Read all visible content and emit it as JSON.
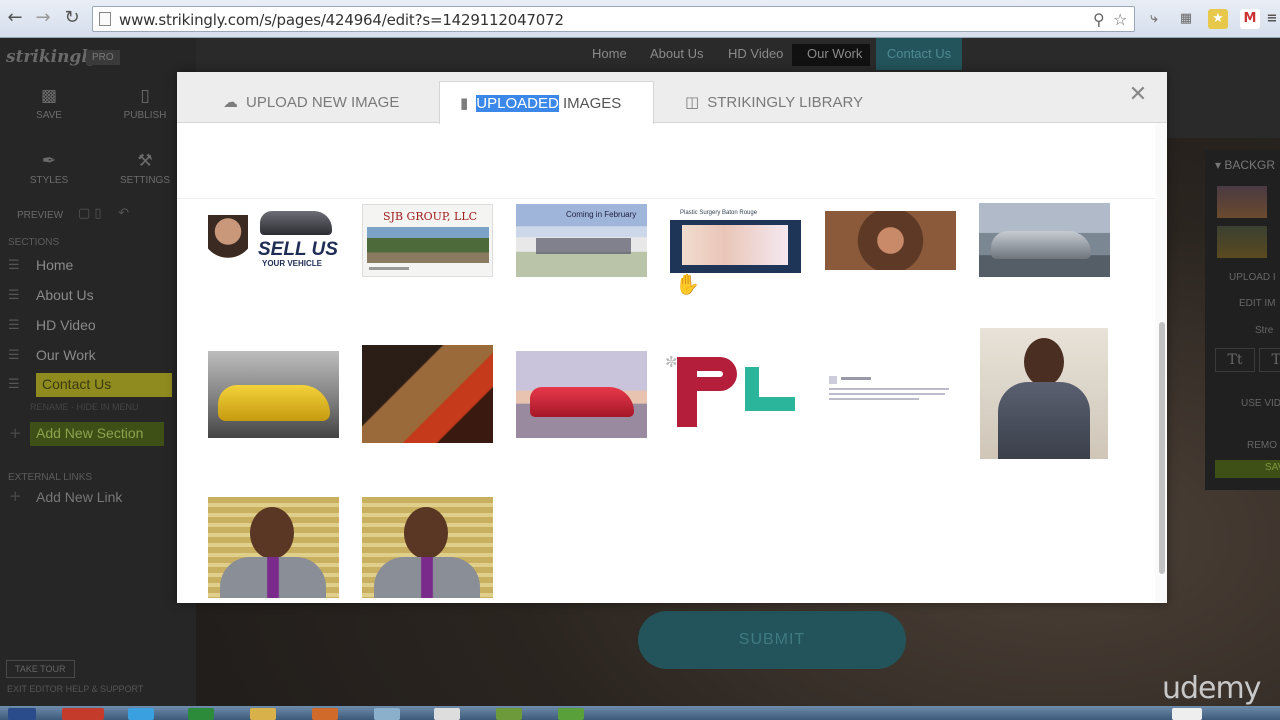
{
  "browser": {
    "url": "www.strikingly.com/s/pages/424964/edit?s=1429112047072",
    "back_icon": "arrow-left-icon",
    "forward_icon": "arrow-right-icon",
    "reload_icon": "reload-icon"
  },
  "sidebar": {
    "logo": "strikingly",
    "badge": "PRO",
    "tools": [
      {
        "label": "SAVE",
        "icon": "save-icon"
      },
      {
        "label": "PUBLISH",
        "icon": "publish-icon"
      },
      {
        "label": "STYLES",
        "icon": "brush-icon"
      },
      {
        "label": "SETTINGS",
        "icon": "wrench-icon"
      }
    ],
    "preview_label": "PREVIEW",
    "sections_header": "SECTIONS",
    "sections": [
      "Home",
      "About Us",
      "HD Video",
      "Our Work",
      "Contact Us"
    ],
    "active_section": "Contact Us",
    "section_actions": "RENAME · HIDE IN MENU",
    "add_section": "Add New Section",
    "external_header": "EXTERNAL LINKS",
    "add_link": "Add New Link",
    "take_tour": "TAKE TOUR",
    "footer": "EXIT EDITOR   HELP & SUPPORT"
  },
  "site": {
    "nav": [
      "Home",
      "About Us",
      "HD Video",
      "Our Work",
      "Contact Us"
    ],
    "submit": "SUBMIT",
    "watermark": "udemy"
  },
  "right_panel": {
    "header": "BACKGR",
    "upload": "UPLOAD I",
    "edit": "EDIT IM",
    "stretch": "Stre",
    "use_video": "USE VID",
    "remove": "REMO",
    "save": "SAVE"
  },
  "modal": {
    "tabs": [
      {
        "label": "UPLOAD NEW IMAGE",
        "icon": "cloud-upload-icon"
      },
      {
        "label_highlight": "UPLOADED",
        "label_rest": " IMAGES",
        "icon": "folder-icon"
      },
      {
        "label": "STRIKINGLY LIBRARY",
        "icon": "archive-icon"
      }
    ],
    "active_tab": "UPLOADED IMAGES",
    "close_icon": "close-icon",
    "thumbnails": [
      {
        "name": "sell-us-your-vehicle",
        "text": "SELL US",
        "subtext": "YOUR VEHICLE"
      },
      {
        "name": "sjb-group-llc",
        "text": "SJB GROUP, LLC"
      },
      {
        "name": "building-february",
        "text": "Coming in February"
      },
      {
        "name": "plastic-surgery-site",
        "text": "Plastic Surgery Baton Rouge"
      },
      {
        "name": "woman-autumn-hair"
      },
      {
        "name": "silver-sedan-dealership"
      },
      {
        "name": "yellow-sports-car"
      },
      {
        "name": "bronze-car-speed"
      },
      {
        "name": "red-lamborghini"
      },
      {
        "name": "pl-logo",
        "text": "PL"
      },
      {
        "name": "testimonial-screenshot"
      },
      {
        "name": "man-in-suit"
      },
      {
        "name": "man-stadium-1"
      },
      {
        "name": "man-stadium-2"
      }
    ]
  }
}
